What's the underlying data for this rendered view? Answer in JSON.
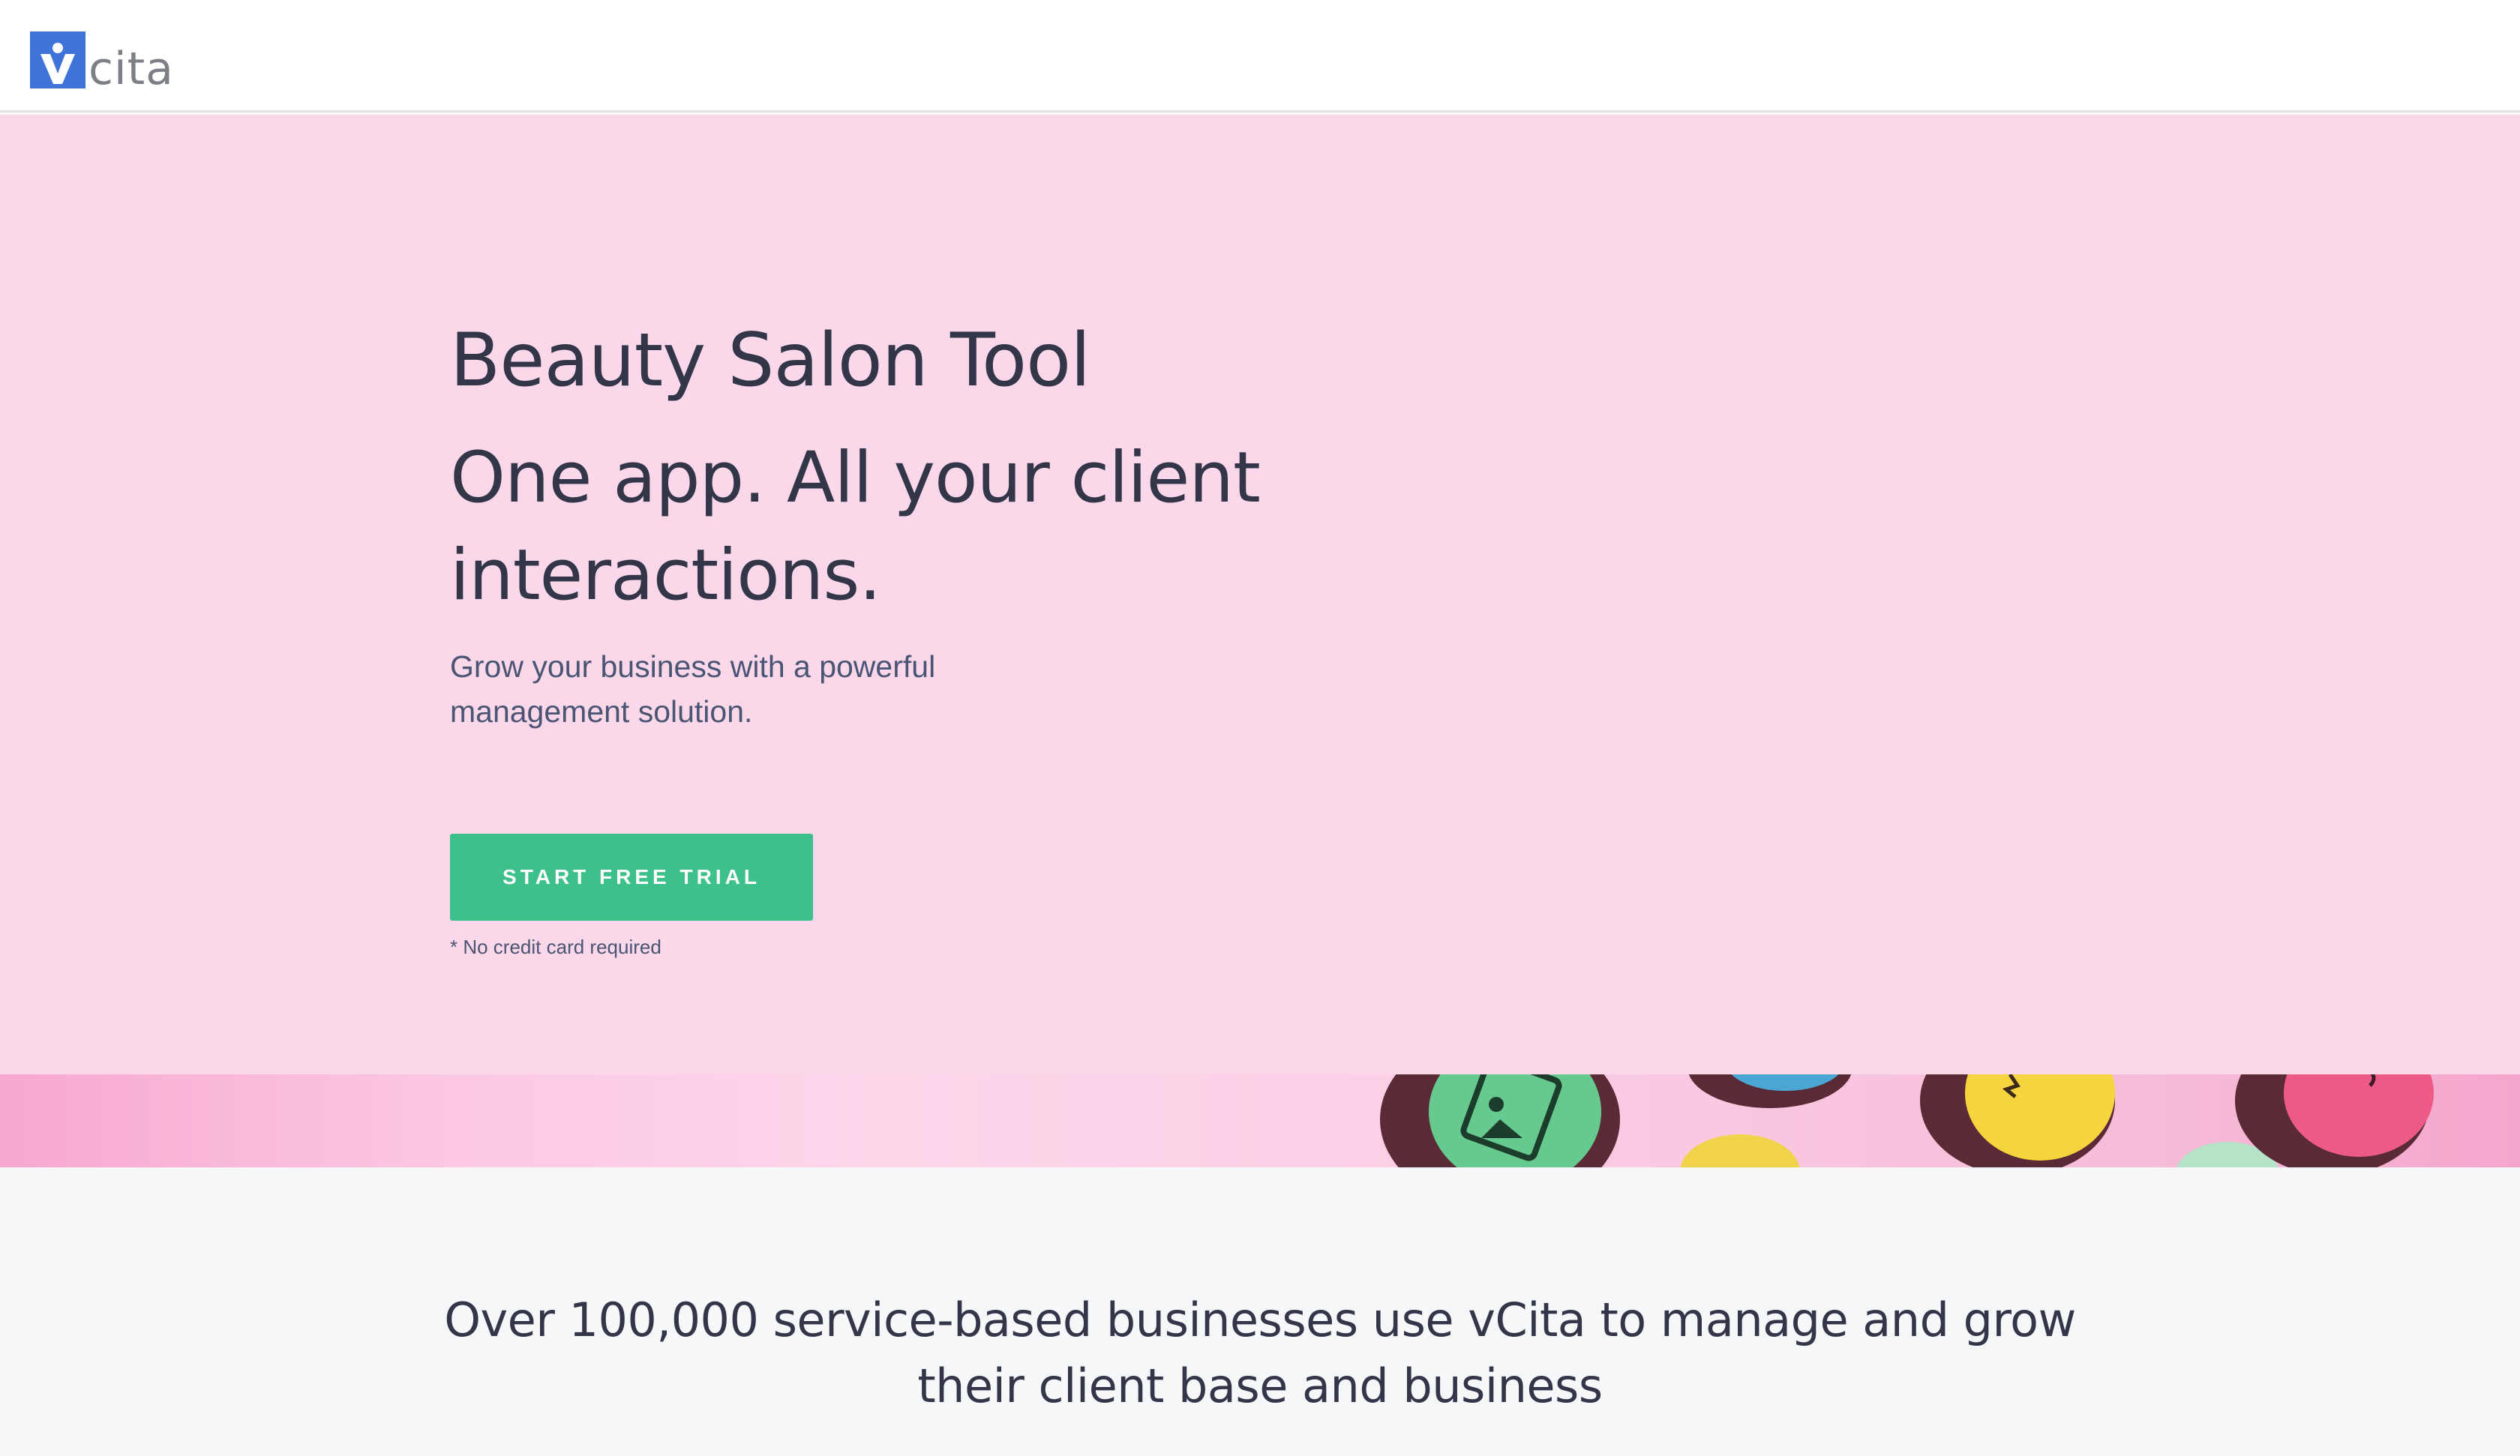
{
  "header": {
    "logo_text": "cita",
    "logo_mark": "v",
    "brand_color": "#3f73d8"
  },
  "hero": {
    "title": "Beauty Salon Tool",
    "headline": "One app. All your client interactions.",
    "subheadline": "Grow your business with a powerful management solution.",
    "cta_label": "START FREE TRIAL",
    "cta_color": "#3ec08b",
    "note": "* No credit card required",
    "background_color": "#fad7e9"
  },
  "decor": {
    "icons": [
      "green-egg-document-icon",
      "yellow-egg-icon",
      "pink-egg-icon",
      "blue-egg-icon"
    ]
  },
  "proof": {
    "text": "Over 100,000 service-based businesses use vCita to manage and grow their client base and business"
  }
}
